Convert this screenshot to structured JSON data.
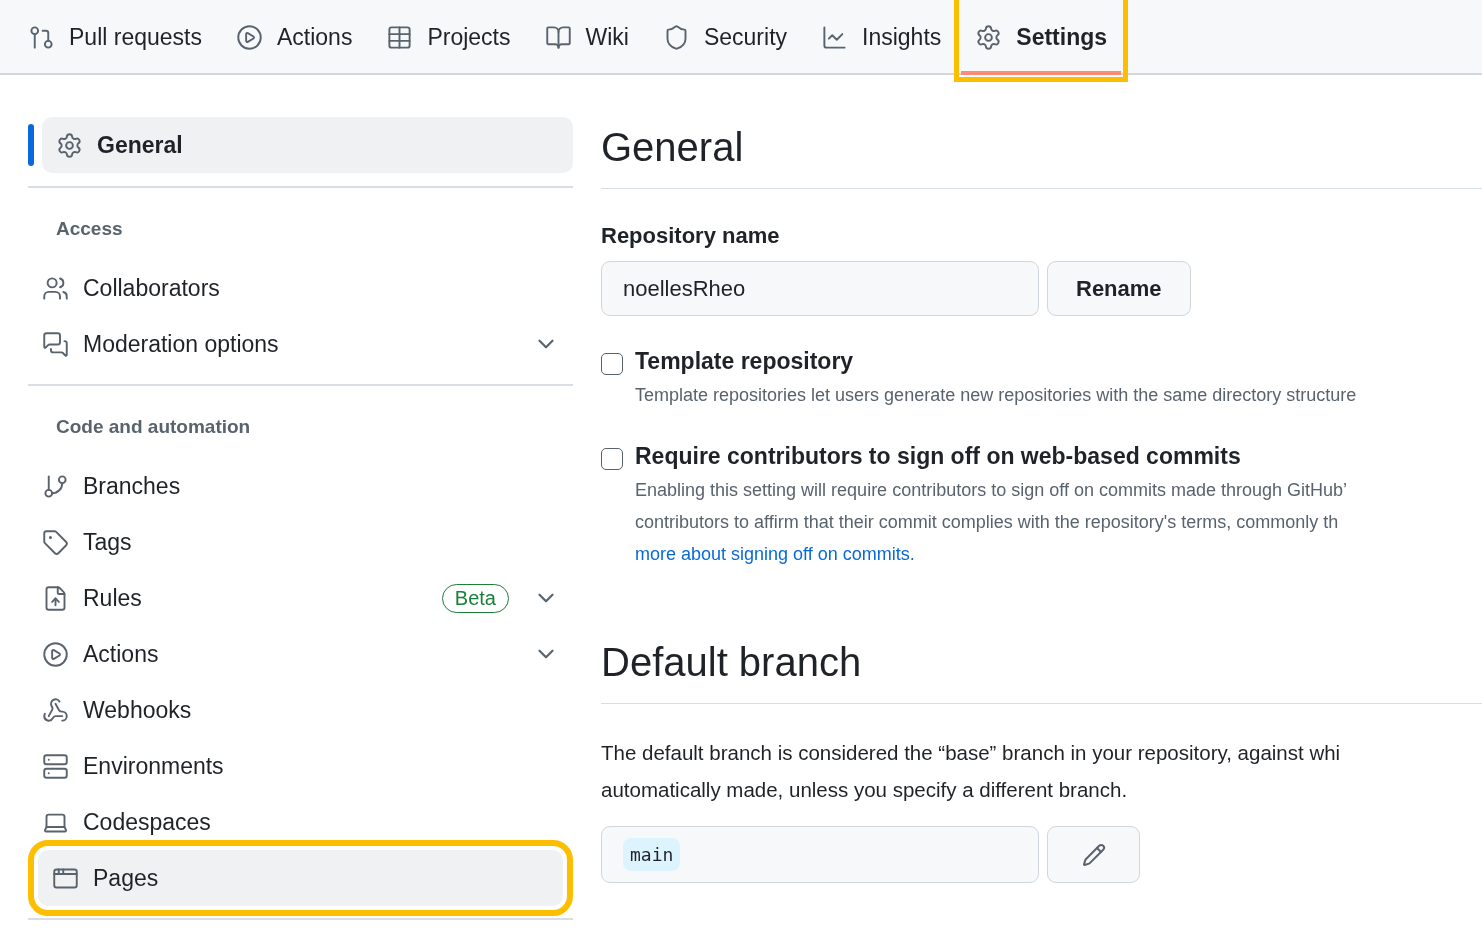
{
  "nav": {
    "tabs": [
      {
        "label": "Pull requests",
        "selected": false,
        "highlighted": false
      },
      {
        "label": "Actions",
        "selected": false,
        "highlighted": false
      },
      {
        "label": "Projects",
        "selected": false,
        "highlighted": false
      },
      {
        "label": "Wiki",
        "selected": false,
        "highlighted": false
      },
      {
        "label": "Security",
        "selected": false,
        "highlighted": false
      },
      {
        "label": "Insights",
        "selected": false,
        "highlighted": false
      },
      {
        "label": "Settings",
        "selected": true,
        "highlighted": true
      }
    ]
  },
  "sidebar": {
    "top": {
      "label": "General",
      "selected": true
    },
    "sections": [
      {
        "heading": "Access",
        "items": [
          {
            "label": "Collaborators",
            "selected": false,
            "expandable": false,
            "highlighted": false
          },
          {
            "label": "Moderation options",
            "selected": false,
            "expandable": true,
            "highlighted": false
          }
        ]
      },
      {
        "heading": "Code and automation",
        "items": [
          {
            "label": "Branches",
            "selected": false,
            "expandable": false,
            "highlighted": false
          },
          {
            "label": "Tags",
            "selected": false,
            "expandable": false,
            "highlighted": false
          },
          {
            "label": "Rules",
            "selected": false,
            "expandable": true,
            "highlighted": false,
            "badge": "Beta"
          },
          {
            "label": "Actions",
            "selected": false,
            "expandable": true,
            "highlighted": false
          },
          {
            "label": "Webhooks",
            "selected": false,
            "expandable": false,
            "highlighted": false
          },
          {
            "label": "Environments",
            "selected": false,
            "expandable": false,
            "highlighted": false
          },
          {
            "label": "Codespaces",
            "selected": false,
            "expandable": false,
            "highlighted": false
          },
          {
            "label": "Pages",
            "selected": false,
            "expandable": false,
            "highlighted": true
          }
        ]
      }
    ]
  },
  "main": {
    "title": "General",
    "repo_name": {
      "label": "Repository name",
      "value": "noellesRheo",
      "button": "Rename"
    },
    "options": [
      {
        "label": "Template repository",
        "checked": false,
        "description": [
          "Template repositories let users generate new repositories with the same directory structure"
        ]
      },
      {
        "label": "Require contributors to sign off on web-based commits",
        "checked": false,
        "description": [
          "Enabling this setting will require contributors to sign off on commits made through GitHub’",
          "contributors to affirm that their commit complies with the repository's terms, commonly th"
        ],
        "link": "more about signing off on commits."
      }
    ],
    "default_branch": {
      "title": "Default branch",
      "description": [
        "The default branch is considered the “base” branch in your repository, against whi",
        "automatically made, unless you specify a different branch."
      ],
      "branch": "main"
    }
  }
}
